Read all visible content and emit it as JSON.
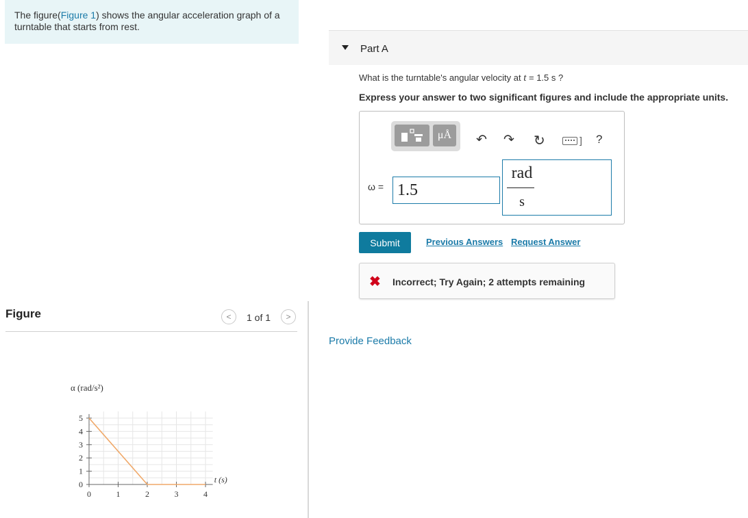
{
  "problem": {
    "intro_prefix": "The figure(",
    "intro_link": "Figure 1",
    "intro_suffix": ") shows the angular acceleration graph of a turntable that starts from rest."
  },
  "figure": {
    "title": "Figure",
    "pager": "1 of 1",
    "prev_glyph": "<",
    "next_glyph": ">"
  },
  "part": {
    "title": "Part A",
    "question_prefix": "What is the turntable's angular velocity at ",
    "question_var": "t",
    "question_suffix": " = 1.5 s ?",
    "instruction": "Express your answer to two significant figures and include the appropriate units."
  },
  "answer": {
    "var_label": "ω =",
    "value": "1.5",
    "unit_numerator": "rad",
    "unit_denominator": "s",
    "units_tool_label": "μÅ",
    "help_label": "?",
    "kbd_bracket": "]"
  },
  "actions": {
    "submit_label": "Submit",
    "previous_answers": "Previous Answers",
    "request_answer": "Request Answer",
    "provide_feedback": "Provide Feedback"
  },
  "feedback": {
    "icon": "✖",
    "text": "Incorrect; Try Again; 2 attempts remaining",
    "color": "#d0021b"
  },
  "chart_data": {
    "type": "line",
    "ylabel": "α (rad/s²)",
    "xlabel": "t (s)",
    "x_ticks": [
      "0",
      "1",
      "2",
      "3",
      "4"
    ],
    "y_ticks": [
      "0",
      "1",
      "2",
      "3",
      "4",
      "5"
    ],
    "xlim": [
      0,
      4
    ],
    "ylim": [
      0,
      5
    ],
    "grid": true,
    "series": [
      {
        "x": [
          0,
          2,
          4
        ],
        "y": [
          5,
          0,
          0
        ]
      }
    ]
  }
}
